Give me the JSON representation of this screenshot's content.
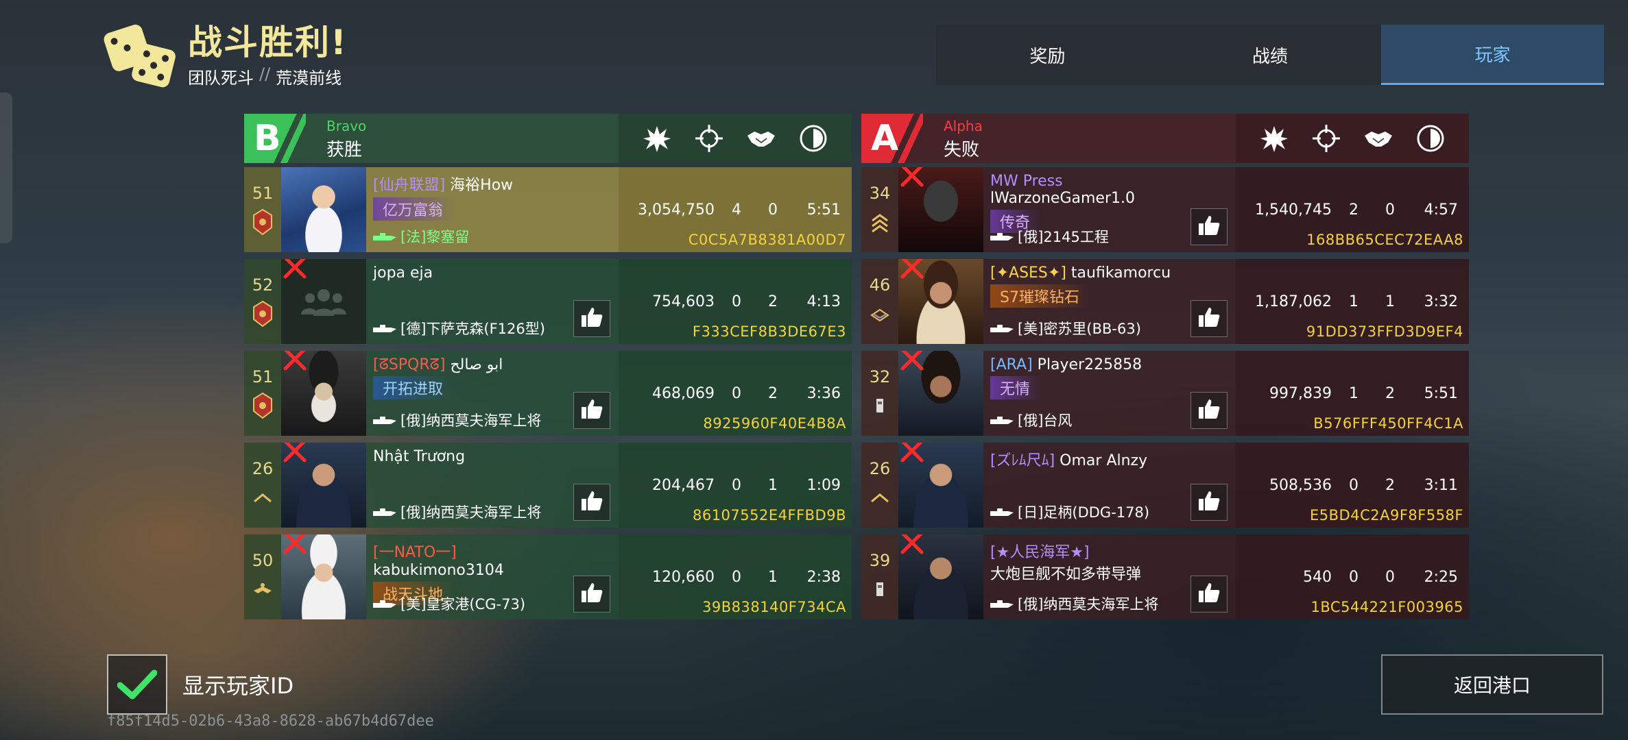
{
  "header": {
    "title": "战斗胜利!",
    "mode": "团队死斗",
    "separator": "//",
    "map": "荒漠前线"
  },
  "tabs": [
    {
      "label": "奖励",
      "active": false
    },
    {
      "label": "战绩",
      "active": false
    },
    {
      "label": "玩家",
      "active": true
    }
  ],
  "columns": [
    "damage-icon",
    "kills-icon",
    "assists-icon",
    "time-icon"
  ],
  "team_b": {
    "letter": "B",
    "code": "Bravo",
    "result": "获胜",
    "color": "#3cc15a",
    "players": [
      {
        "rank": "51",
        "clan": "[仙舟联盟]",
        "name": "海裕How",
        "title": "亿万富翁",
        "ship": "[法]黎塞留",
        "score": "3,054,750",
        "kills": "4",
        "assists": "0",
        "time": "5:51",
        "pid": "C0C5A7B8381A00D7"
      },
      {
        "rank": "52",
        "clan": "",
        "name": "jopa eja",
        "title": "",
        "ship": "[德]下萨克森(F126型)",
        "score": "754,603",
        "kills": "0",
        "assists": "2",
        "time": "4:13",
        "pid": "F333CEF8B3DE67E3"
      },
      {
        "rank": "51",
        "clan": "[ᘔSPQRᘔ]",
        "name": "ابو صالح",
        "title": "开拓进取",
        "ship": "[俄]纳西莫夫海军上将",
        "score": "468,069",
        "kills": "0",
        "assists": "2",
        "time": "3:36",
        "pid": "8925960F40E4B8A"
      },
      {
        "rank": "26",
        "clan": "",
        "name": "Nhật Trương",
        "title": "",
        "ship": "[俄]纳西莫夫海军上将",
        "score": "204,467",
        "kills": "0",
        "assists": "1",
        "time": "1:09",
        "pid": "86107552E4FFBD9B"
      },
      {
        "rank": "50",
        "clan": "[一NATO一]",
        "name": "kabukimono3104",
        "title": "战天斗地",
        "ship": "[美]皇家港(CG-73)",
        "score": "120,660",
        "kills": "0",
        "assists": "1",
        "time": "2:38",
        "pid": "39B838140F734CA"
      }
    ]
  },
  "team_a": {
    "letter": "A",
    "code": "Alpha",
    "result": "失败",
    "color": "#e02a36",
    "players": [
      {
        "rank": "34",
        "clan": "MW Press",
        "name": "lWarzoneGamer1.0",
        "title": "传奇",
        "ship": "[俄]2145工程",
        "score": "1,540,745",
        "kills": "2",
        "assists": "0",
        "time": "4:57",
        "pid": "168BB65CEC72EAA8"
      },
      {
        "rank": "46",
        "clan": "[✦ASES✦]",
        "name": "taufikamorcu",
        "title": "S7璀璨钻石",
        "ship": "[美]密苏里(BB-63)",
        "score": "1,187,062",
        "kills": "1",
        "assists": "1",
        "time": "3:32",
        "pid": "91DD373FFD3D9EF4"
      },
      {
        "rank": "32",
        "clan": "[ARA]",
        "name": "Player225858",
        "title": "无情",
        "ship": "[俄]台风",
        "score": "997,839",
        "kills": "1",
        "assists": "2",
        "time": "5:51",
        "pid": "B576FFF450FF4C1A"
      },
      {
        "rank": "26",
        "clan": "[ズﾚﾑ尺ﾑ]",
        "name": "Omar Alnzy",
        "title": "",
        "ship": "[日]足柄(DDG-178)",
        "score": "508,536",
        "kills": "0",
        "assists": "2",
        "time": "3:11",
        "pid": "E5BD4C2A9F8F558F"
      },
      {
        "rank": "39",
        "clan": "[★人民海军★]",
        "name": "大炮巨舰不如多带导弹",
        "title": "",
        "ship": "[俄]纳西莫夫海军上将",
        "score": "540",
        "kills": "0",
        "assists": "0",
        "time": "2:25",
        "pid": "1BC544221F003965"
      }
    ]
  },
  "footer": {
    "show_id_label": "显示玩家ID",
    "show_id_checked": true,
    "match_id": "f85f14d5-02b6-43a8-8628-ab67b4d67dee",
    "return_label": "返回港口"
  }
}
